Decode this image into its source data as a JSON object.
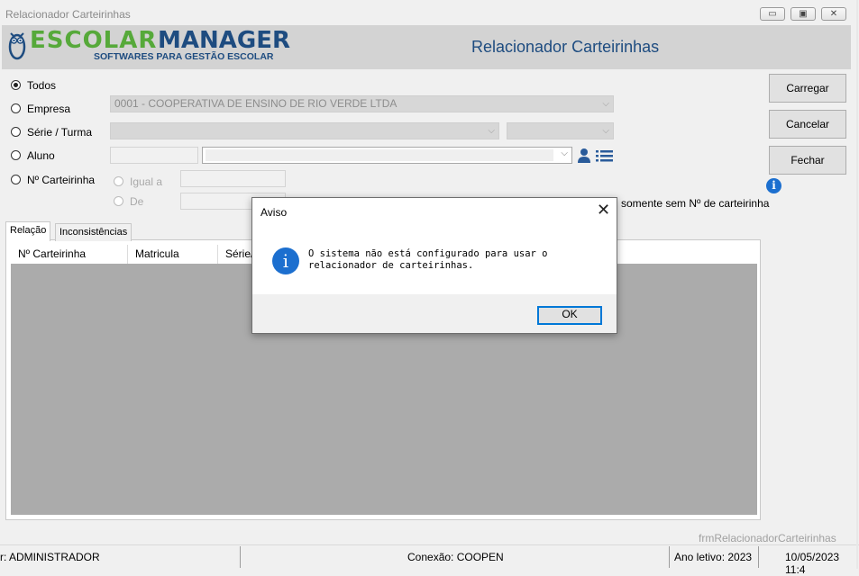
{
  "window": {
    "title": "Relacionador Carteirinhas",
    "controls": [
      "minimize-icon",
      "maximize-icon",
      "close-icon"
    ]
  },
  "header": {
    "logo_escolar": "ESCOLAR",
    "logo_manager": "MANAGER",
    "logo_tagline": "SOFTWARES PARA GESTÃO ESCOLAR",
    "form_title": "Relacionador Carteirinhas"
  },
  "filters": {
    "todos": "Todos",
    "empresa": "Empresa",
    "serie_turma": "Série / Turma",
    "aluno": "Aluno",
    "n_carteirinha": "Nº Carteirinha",
    "empresa_value": "0001 - COOPERATIVA DE ENSINO DE RIO VERDE LTDA",
    "igual_a": "Igual a",
    "de": "De",
    "somente_sem": "somente sem Nº de carteirinha"
  },
  "buttons": {
    "carregar": "Carregar",
    "cancelar": "Cancelar",
    "fechar": "Fechar"
  },
  "tabs": [
    "Relação",
    "Inconsistências"
  ],
  "grid": {
    "columns": [
      "Nº Carteirinha",
      "Matricula",
      "Série/"
    ]
  },
  "dialog": {
    "title": "Aviso",
    "message": "O sistema não está configurado para usar o relacionador de carteirinhas.",
    "ok": "OK"
  },
  "form_name": "frmRelacionadorCarteirinhas",
  "status": {
    "user": "r: ADMINISTRADOR",
    "connection": "Conexão: COOPEN",
    "ano_letivo": "Ano letivo: 2023",
    "datetime": "10/05/2023 11:4"
  },
  "colors": {
    "brand_green": "#56a93a",
    "brand_blue": "#1e4c80",
    "info_blue": "#1c6fcf",
    "grid_gray": "#ababab"
  }
}
